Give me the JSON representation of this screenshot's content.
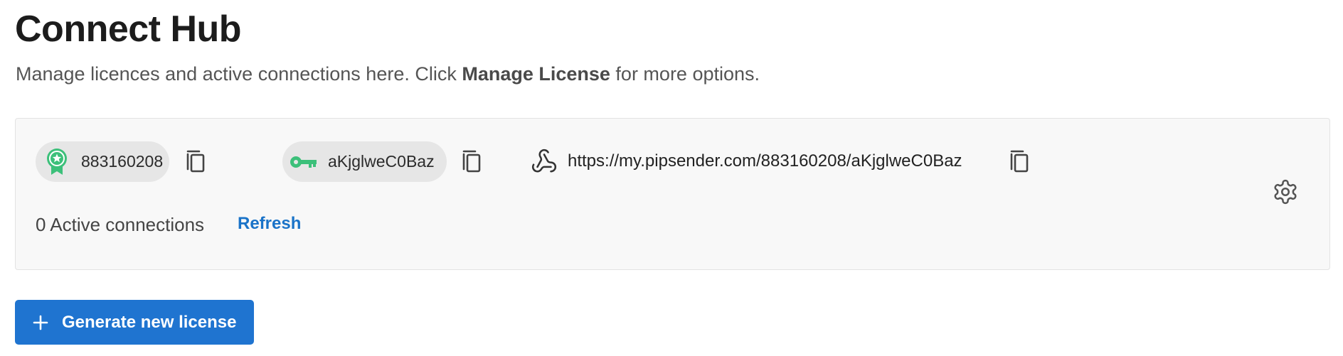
{
  "header": {
    "title": "Connect Hub",
    "subtitle_prefix": "Manage licences and active connections here. Click ",
    "subtitle_bold": "Manage License",
    "subtitle_suffix": " for more options."
  },
  "license_card": {
    "license_id": "883160208",
    "license_icon": "award-badge-icon",
    "api_key": "aKjglweC0Baz",
    "key_icon": "key-icon",
    "url_icon": "webhook-icon",
    "url": "https://my.pipsender.com/883160208/aKjglweC0Baz",
    "copy_icon": "copy-icon",
    "settings_icon": "gear-icon",
    "connections_text": "0 Active connections",
    "refresh_label": "Refresh"
  },
  "actions": {
    "generate_label": "Generate new license",
    "generate_icon": "plus-icon"
  },
  "colors": {
    "accent": "#1f74d0",
    "link": "#1a73c8",
    "icon_green": "#3cc07a",
    "card_bg": "#f8f8f8"
  }
}
